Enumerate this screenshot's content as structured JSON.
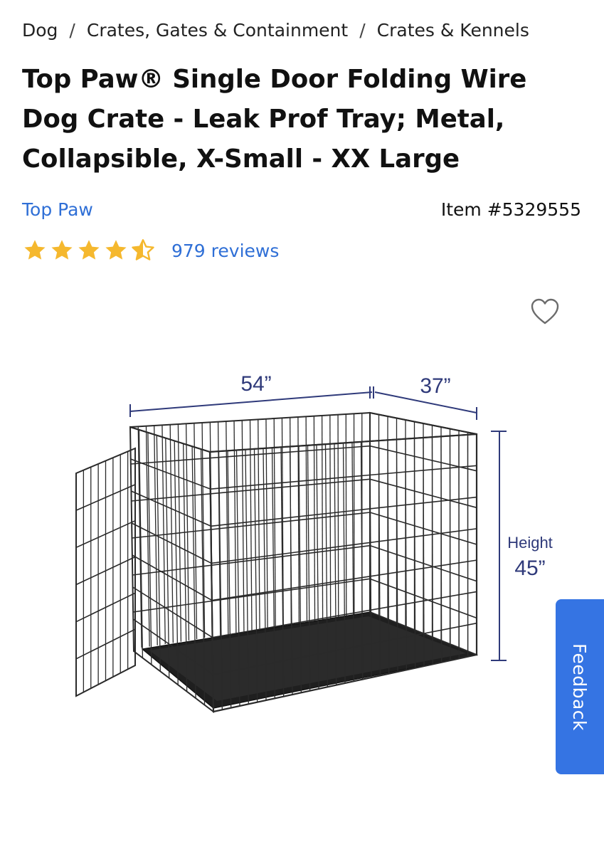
{
  "breadcrumb": {
    "items": [
      "Dog",
      "Crates, Gates & Containment",
      "Crates & Kennels"
    ],
    "separator": "/"
  },
  "product": {
    "title": "Top Paw® Single Door Folding Wire Dog Crate - Leak Prof Tray; Metal, Collapsible, X-Small - XX Large",
    "brand": "Top Paw",
    "item_number": "Item #5329555",
    "rating": 4.5,
    "rating_max": 5,
    "reviews": "979 reviews"
  },
  "image": {
    "width_label": "54”",
    "depth_label": "37”",
    "height_caption": "Height",
    "height_label": "45”"
  },
  "feedback": {
    "label": "Feedback"
  },
  "colors": {
    "accent": "#2f6fd6",
    "star": "#f5b82e",
    "feedback_bg": "#3574e3"
  },
  "icons": {
    "favorite": "heart-outline-icon",
    "star": "star-icon",
    "half_star": "star-half-icon"
  }
}
